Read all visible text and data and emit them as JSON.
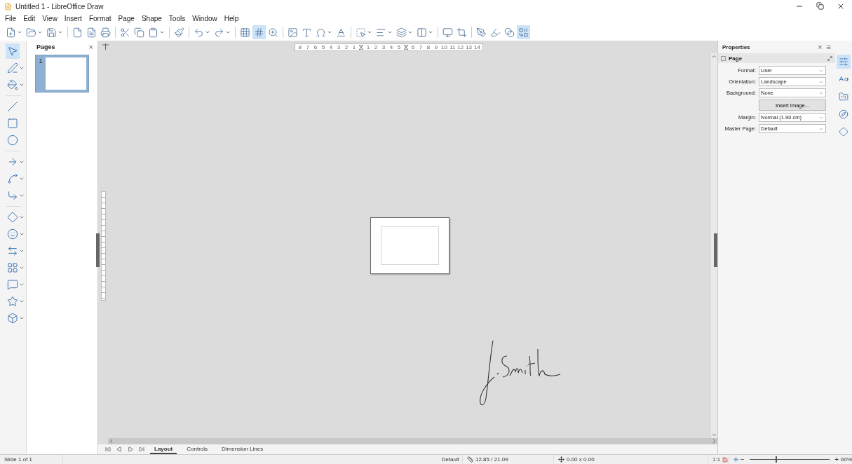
{
  "window": {
    "title": "Untitled 1 - LibreOffice Draw"
  },
  "menu": [
    "File",
    "Edit",
    "View",
    "Insert",
    "Format",
    "Page",
    "Shape",
    "Tools",
    "Window",
    "Help"
  ],
  "toolbar": [
    {
      "kind": "new",
      "menu": true,
      "selected": false
    },
    {
      "kind": "open",
      "menu": true,
      "selected": false
    },
    {
      "kind": "save",
      "menu": true,
      "selected": false
    },
    {
      "kind": "sep"
    },
    {
      "kind": "export",
      "menu": false,
      "selected": false
    },
    {
      "kind": "pdf",
      "menu": false,
      "selected": false
    },
    {
      "kind": "print",
      "menu": false,
      "selected": false
    },
    {
      "kind": "sep"
    },
    {
      "kind": "cut",
      "menu": false,
      "selected": false
    },
    {
      "kind": "copy",
      "menu": false,
      "selected": false
    },
    {
      "kind": "paste",
      "menu": true,
      "selected": false
    },
    {
      "kind": "sep"
    },
    {
      "kind": "brush",
      "menu": false,
      "selected": false
    },
    {
      "kind": "sep"
    },
    {
      "kind": "undo",
      "menu": true,
      "selected": false
    },
    {
      "kind": "redo",
      "menu": true,
      "selected": false
    },
    {
      "kind": "sep"
    },
    {
      "kind": "grid",
      "menu": false,
      "selected": false
    },
    {
      "kind": "snap",
      "menu": false,
      "selected": true
    },
    {
      "kind": "zoom",
      "menu": false,
      "selected": false
    },
    {
      "kind": "sep"
    },
    {
      "kind": "image",
      "menu": false,
      "selected": false
    },
    {
      "kind": "textbox",
      "menu": false,
      "selected": false
    },
    {
      "kind": "omega",
      "menu": true,
      "selected": false
    },
    {
      "kind": "fontwork",
      "menu": false,
      "selected": false
    },
    {
      "kind": "sep"
    },
    {
      "kind": "transform",
      "menu": true,
      "selected": false
    },
    {
      "kind": "align",
      "menu": true,
      "selected": false
    },
    {
      "kind": "arrange",
      "menu": true,
      "selected": false
    },
    {
      "kind": "distribute",
      "menu": true,
      "selected": false
    },
    {
      "kind": "sep"
    },
    {
      "kind": "shadow",
      "menu": false,
      "selected": false
    },
    {
      "kind": "crop",
      "menu": false,
      "selected": false
    },
    {
      "kind": "sep"
    },
    {
      "kind": "points",
      "menu": false,
      "selected": false
    },
    {
      "kind": "glue",
      "menu": false,
      "selected": false
    },
    {
      "kind": "toggle",
      "menu": false,
      "selected": false
    },
    {
      "kind": "extrusion",
      "menu": false,
      "selected": true
    }
  ],
  "tools": [
    {
      "kind": "select",
      "menu": false,
      "selected": true
    },
    {
      "kind": "line-color",
      "menu": true,
      "selected": false
    },
    {
      "kind": "fill-color",
      "menu": true,
      "selected": false
    },
    {
      "kind": "sep"
    },
    {
      "kind": "line",
      "menu": false,
      "selected": false
    },
    {
      "kind": "rectangle",
      "menu": false,
      "selected": false
    },
    {
      "kind": "ellipse",
      "menu": false,
      "selected": false
    },
    {
      "kind": "sep"
    },
    {
      "kind": "arrow",
      "menu": true,
      "selected": false
    },
    {
      "kind": "curve",
      "menu": true,
      "selected": false
    },
    {
      "kind": "connector",
      "menu": true,
      "selected": false
    },
    {
      "kind": "sep"
    },
    {
      "kind": "diamond",
      "menu": true,
      "selected": false
    },
    {
      "kind": "smiley",
      "menu": true,
      "selected": false
    },
    {
      "kind": "double-arrow",
      "menu": true,
      "selected": false
    },
    {
      "kind": "flowchart",
      "menu": true,
      "selected": false
    },
    {
      "kind": "callout",
      "menu": true,
      "selected": false
    },
    {
      "kind": "star",
      "menu": true,
      "selected": false
    },
    {
      "kind": "cube",
      "menu": true,
      "selected": false
    }
  ],
  "pages_panel": {
    "title": "Pages",
    "close": "×",
    "pages": [
      {
        "number": "1",
        "selected": true
      }
    ]
  },
  "ruler": [
    {
      "kind": "number",
      "label": "8"
    },
    {
      "kind": "number",
      "label": "7"
    },
    {
      "kind": "number",
      "label": "6"
    },
    {
      "kind": "number",
      "label": "5"
    },
    {
      "kind": "number",
      "label": "4"
    },
    {
      "kind": "number",
      "label": "3"
    },
    {
      "kind": "number",
      "label": "2"
    },
    {
      "kind": "number",
      "label": "1"
    },
    {
      "kind": "marker"
    },
    {
      "kind": "number",
      "label": "1"
    },
    {
      "kind": "number",
      "label": "2"
    },
    {
      "kind": "number",
      "label": "3"
    },
    {
      "kind": "number",
      "label": "4"
    },
    {
      "kind": "number",
      "label": "5"
    },
    {
      "kind": "marker"
    },
    {
      "kind": "number",
      "label": "6"
    },
    {
      "kind": "number",
      "label": "7"
    },
    {
      "kind": "number",
      "label": "8"
    },
    {
      "kind": "number",
      "label": "9"
    },
    {
      "kind": "number",
      "label": "10"
    },
    {
      "kind": "number",
      "label": "11"
    },
    {
      "kind": "number",
      "label": "12"
    },
    {
      "kind": "number",
      "label": "13"
    },
    {
      "kind": "number",
      "label": "14"
    }
  ],
  "sheet_tabs": [
    {
      "label": "Layout",
      "selected": true
    },
    {
      "label": "Controls",
      "selected": false
    },
    {
      "label": "Dimension Lines",
      "selected": false
    }
  ],
  "sidebar": {
    "title": "Properties",
    "close": "×",
    "menu": "≡",
    "section": "Page",
    "fields": [
      {
        "label": "Format:",
        "value": "User"
      },
      {
        "label": "Orientation:",
        "value": "Landscape"
      },
      {
        "label": "Background:",
        "value": "None"
      }
    ],
    "button": "Insert Image...",
    "fields_2": [
      {
        "label": "Margin:",
        "value": "Normal (1.90 cm)"
      },
      {
        "label": "Master Page:",
        "value": "Default"
      }
    ],
    "deck": [
      {
        "kind": "properties",
        "selected": true
      },
      {
        "kind": "styles",
        "selected": false
      },
      {
        "kind": "gallery",
        "selected": false
      },
      {
        "kind": "navigator",
        "selected": false
      },
      {
        "kind": "shapes",
        "selected": false
      }
    ]
  },
  "status_bar": {
    "slide": "Slide 1 of 1",
    "layout": "Default",
    "position": "12.85 / 21.09",
    "size": "0.00 x 0.00",
    "scale": "1:1",
    "zoom": {
      "level": 0.33
    },
    "zoom_minus": "−",
    "zoom_plus": "+",
    "zoom_reading": "60%"
  }
}
